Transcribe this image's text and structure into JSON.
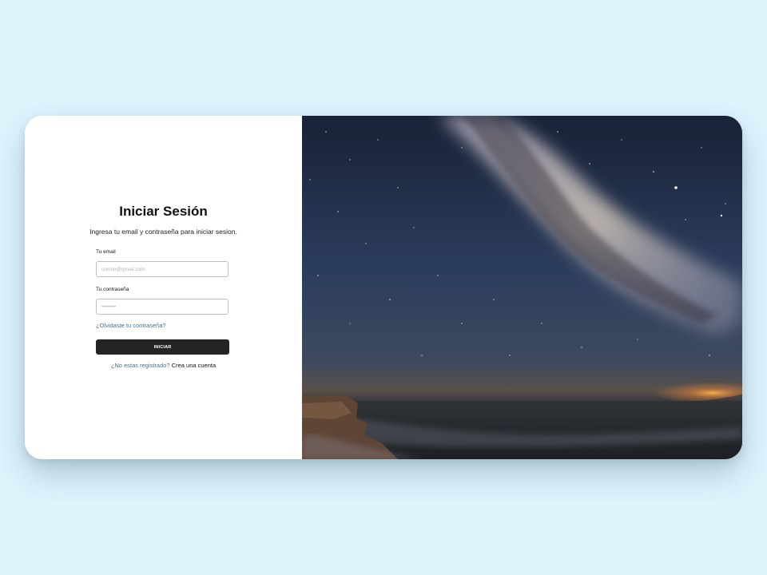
{
  "login": {
    "title": "Iniciar Sesión",
    "subtitle": "Ingresa tu email y contraseña para iniciar sesion.",
    "email": {
      "label": "Tu email",
      "placeholder": "correo@gmail.com",
      "value": ""
    },
    "password": {
      "label": "Tu contraseña",
      "placeholder": "••••••••",
      "value": ""
    },
    "forgot_link": "¿Olvidaste tu contraseña?",
    "submit_label": "INICIAR",
    "register_question": "¿No estas registrado?",
    "register_link": "Crea una cuenta"
  },
  "hero_image": {
    "description_icon": "night-sky-milky-way-seascape-image"
  },
  "colors": {
    "page_background": "#dff4fd",
    "card_background": "#ffffff",
    "button_background": "#242424",
    "link_color": "#4a6f8a"
  }
}
